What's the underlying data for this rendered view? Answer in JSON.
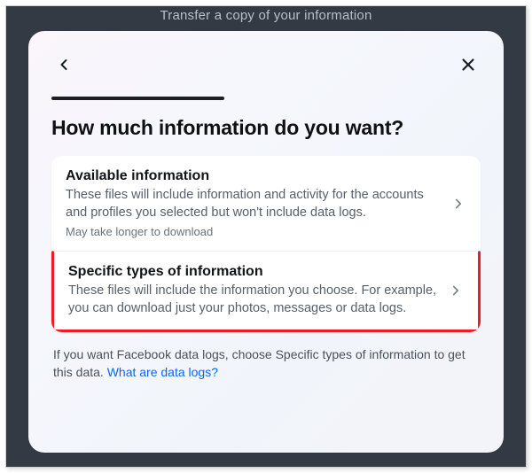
{
  "background": {
    "truncated_title": "Transfer a copy of your information"
  },
  "modal": {
    "title": "How much information do you want?",
    "options": [
      {
        "title": "Available information",
        "desc": "These files will include information and activity for the accounts and profiles you selected but won't include data logs.",
        "note": "May take longer to download"
      },
      {
        "title": "Specific types of information",
        "desc": "These files will include the information you choose. For example, you can download just your photos, messages or data logs."
      }
    ],
    "footer": {
      "text_prefix": "If you want Facebook data logs, choose Specific types of information to get this data. ",
      "link_text": "What are data logs?"
    }
  }
}
